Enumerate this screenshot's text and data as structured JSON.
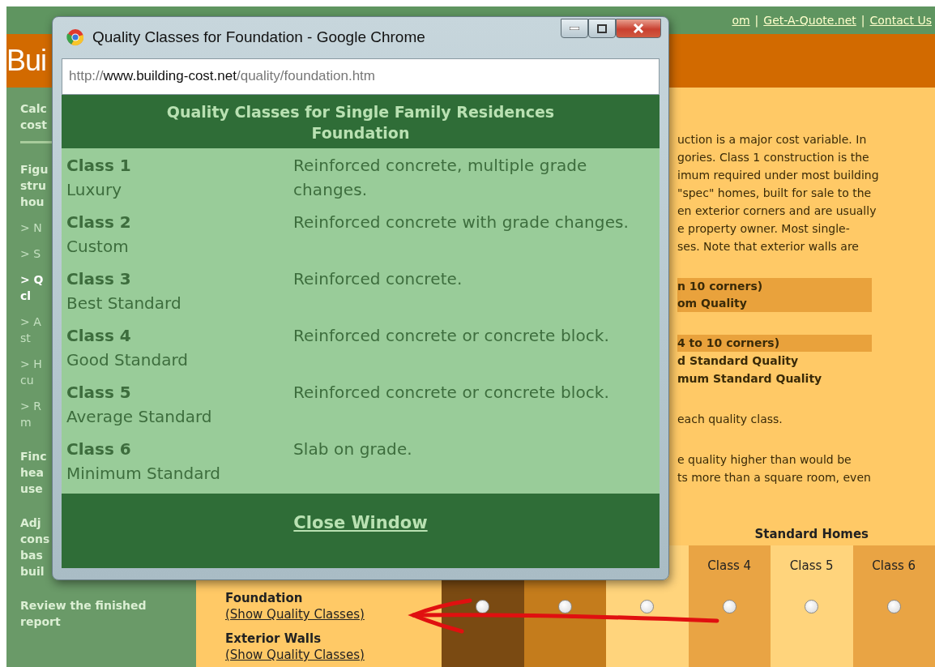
{
  "top_links": {
    "items": [
      "om",
      "Get-A-Quote.net",
      "Contact Us"
    ],
    "separator": "|"
  },
  "header": {
    "title": "Bui"
  },
  "sidebar": {
    "items": [
      {
        "kind": "section",
        "lines": [
          "Calc",
          "cost"
        ]
      },
      {
        "kind": "section",
        "lines": [
          "Figu",
          "stru",
          "hou"
        ]
      },
      {
        "kind": "step",
        "selected": false,
        "lines": [
          "> N"
        ]
      },
      {
        "kind": "step",
        "selected": false,
        "lines": [
          "> S"
        ]
      },
      {
        "kind": "step",
        "selected": true,
        "lines": [
          "> Q",
          "cl"
        ]
      },
      {
        "kind": "step",
        "selected": false,
        "lines": [
          "> A",
          "st"
        ]
      },
      {
        "kind": "step",
        "selected": false,
        "lines": [
          "> H",
          "cu"
        ]
      },
      {
        "kind": "step",
        "selected": false,
        "lines": [
          "> R",
          "m"
        ]
      },
      {
        "kind": "section",
        "lines": [
          "Finc",
          "hea",
          "use"
        ]
      },
      {
        "kind": "section",
        "lines": [
          "Adj",
          "cons",
          "bas",
          "buil"
        ]
      },
      {
        "kind": "section",
        "lines": [
          "Review the finished",
          "report"
        ]
      }
    ]
  },
  "content": {
    "blocks": [
      {
        "kind": "paragraph",
        "lines": [
          "uction is a major cost variable. In",
          "gories. Class 1 construction is the",
          "imum required under most building",
          "\"spec\" homes, built for sale to the",
          "en exterior corners and are usually",
          "e property owner. Most single-",
          "ses. Note that exterior walls are"
        ]
      },
      {
        "kind": "highlight",
        "lines": [
          "n 10 corners)",
          "om Quality"
        ]
      },
      {
        "kind": "highlight",
        "lines": [
          "4 to 10 corners)"
        ]
      },
      {
        "kind": "bold",
        "lines": [
          "d Standard Quality",
          "mum Standard Quality"
        ]
      },
      {
        "kind": "paragraph",
        "lines": [
          "each quality class."
        ]
      },
      {
        "kind": "paragraph",
        "lines": [
          "e quality higher than would be",
          "ts more than a square room, even"
        ]
      }
    ]
  },
  "quality_table": {
    "group_heading": "Standard Homes",
    "columns": [
      {
        "color": "#7a4a12"
      },
      {
        "color": "#c47c1c"
      },
      {
        "color": "#ffd47c"
      },
      {
        "header": "Class 4",
        "color": "#e9a444"
      },
      {
        "header": "Class 5",
        "color": "#ffd47c"
      },
      {
        "header": "Class 6",
        "color": "#e9a444"
      }
    ],
    "rows": [
      {
        "label": "Foundation",
        "link": "(Show Quality Classes)",
        "choices": [
          {
            "selected": false
          },
          {
            "selected": false
          },
          {
            "selected": false
          },
          {
            "selected": false
          },
          {
            "selected": false
          },
          {
            "selected": false
          }
        ]
      },
      {
        "label": "Exterior Walls",
        "link": "(Show Quality Classes)"
      }
    ]
  },
  "popup": {
    "title": "Quality Classes for Foundation - Google Chrome",
    "url": {
      "scheme": "http://",
      "host": "www.building-cost.net",
      "path": "/quality/foundation.htm"
    },
    "heading": [
      "Quality Classes for Single Family Residences",
      "Foundation"
    ],
    "classes": [
      {
        "name": "Class 1",
        "grade": "Luxury",
        "description": "Reinforced concrete, multiple grade changes."
      },
      {
        "name": "Class 2",
        "grade": "Custom",
        "description": "Reinforced concrete with grade changes."
      },
      {
        "name": "Class 3",
        "grade": "Best Standard",
        "description": "Reinforced concrete."
      },
      {
        "name": "Class 4",
        "grade": "Good Standard",
        "description": "Reinforced concrete or concrete block."
      },
      {
        "name": "Class 5",
        "grade": "Average Standard",
        "description": "Reinforced concrete or concrete block."
      },
      {
        "name": "Class 6",
        "grade": "Minimum Standard",
        "description": "Slab on grade."
      }
    ],
    "close_link": "Close Window"
  }
}
